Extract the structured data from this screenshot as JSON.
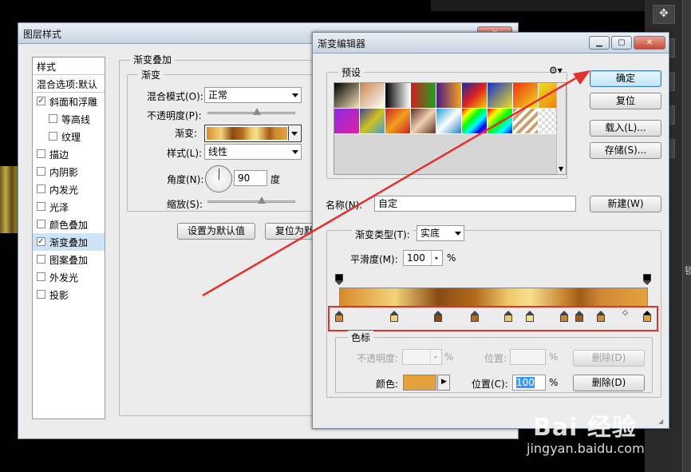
{
  "background": {
    "right_panel_label": "锁"
  },
  "layer_style": {
    "title": "图层样式",
    "styles_header": "样式",
    "blend_default": "混合选项:默认",
    "items": [
      {
        "label": "斜面和浮雕",
        "checked": true
      },
      {
        "label": "等高线",
        "checked": false
      },
      {
        "label": "纹理",
        "checked": false
      },
      {
        "label": "描边",
        "checked": false
      },
      {
        "label": "内阴影",
        "checked": false
      },
      {
        "label": "内发光",
        "checked": false
      },
      {
        "label": "光泽",
        "checked": false
      },
      {
        "label": "颜色叠加",
        "checked": false
      },
      {
        "label": "渐变叠加",
        "checked": true,
        "selected": true
      },
      {
        "label": "图案叠加",
        "checked": false
      },
      {
        "label": "外发光",
        "checked": false
      },
      {
        "label": "投影",
        "checked": false
      }
    ],
    "section_title": "渐变叠加",
    "sub_title": "渐变",
    "blend_mode_label": "混合模式(O):",
    "blend_mode_value": "正常",
    "opacity_label": "不透明度(P):",
    "gradient_label": "渐变:",
    "style_label": "样式(L):",
    "style_value": "线性",
    "angle_label": "角度(N):",
    "angle_value": "90",
    "angle_unit": "度",
    "scale_label": "缩放(S):",
    "make_default_button": "设置为默认值",
    "reset_default_button": "复位为默认值"
  },
  "gradient_editor": {
    "title": "渐变编辑器",
    "presets_label": "预设",
    "ok_button": "确定",
    "reset_button": "复位",
    "load_button": "载入(L)...",
    "save_button": "存储(S)...",
    "name_label": "名称(N):",
    "name_value": "自定",
    "new_button": "新建(W)",
    "gradient_type_label": "渐变类型(T):",
    "gradient_type_value": "实底",
    "smoothness_label": "平滑度(M):",
    "smoothness_value": "100",
    "percent": "%",
    "stops_group_label": "色标",
    "opacity_label": "不透明度:",
    "location_label": "位置:",
    "delete_button": "删除(D)",
    "color_label": "颜色:",
    "color_location_label": "位置(C):",
    "color_location_value": "100",
    "stop_color_hex": "#e4a23c",
    "color_stops": [
      {
        "position": 0,
        "color": "#d98a2a"
      },
      {
        "position": 18,
        "color": "#f2d37a"
      },
      {
        "position": 32,
        "color": "#8a4a12"
      },
      {
        "position": 44,
        "color": "#b36a1c"
      },
      {
        "position": 55,
        "color": "#f0c96a"
      },
      {
        "position": 62,
        "color": "#f6e08e"
      },
      {
        "position": 73,
        "color": "#c88430"
      },
      {
        "position": 78,
        "color": "#a25a18"
      },
      {
        "position": 85,
        "color": "#d08a34"
      },
      {
        "position": 100,
        "color": "#e4a23c",
        "selected": true
      }
    ]
  },
  "watermark": {
    "brand": "Bai 经验",
    "url": "jingyan.baidu.com"
  }
}
